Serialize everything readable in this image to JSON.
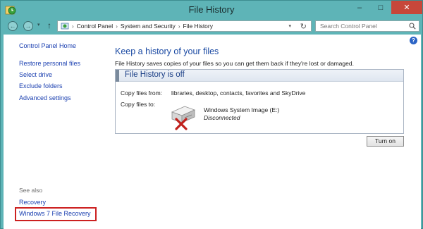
{
  "window": {
    "title": "File History",
    "controls": {
      "minimize": "–",
      "maximize": "□",
      "close": "✕"
    }
  },
  "address_bar": {
    "breadcrumb": [
      "Control Panel",
      "System and Security",
      "File History"
    ],
    "separator": "›",
    "search_placeholder": "Search Control Panel",
    "icons": [
      "back-arrow-icon",
      "forward-arrow-icon",
      "up-arrow-icon",
      "refresh-icon",
      "search-icon"
    ]
  },
  "left_pane": {
    "home_link": "Control Panel Home",
    "links": [
      "Restore personal files",
      "Select drive",
      "Exclude folders",
      "Advanced settings"
    ],
    "see_also_label": "See also",
    "see_also_links": [
      "Recovery",
      "Windows 7 File Recovery"
    ]
  },
  "main": {
    "title": "Keep a history of your files",
    "description": "File History saves copies of your files so you can get them back if they're lost or damaged.",
    "status_title": "File History is off",
    "copy_from_label": "Copy files from:",
    "copy_from_value": "libraries, desktop, contacts, favorites and SkyDrive",
    "copy_to_label": "Copy files to:",
    "drive_name": "Windows System Image (E:)",
    "drive_status": "Disconnected",
    "turn_on_button": "Turn on"
  },
  "colors": {
    "chrome": "#5eb4b7",
    "link": "#1a3fb0",
    "heading": "#1b4aa3",
    "highlight": "#cc2020",
    "error": "#c0201c"
  }
}
